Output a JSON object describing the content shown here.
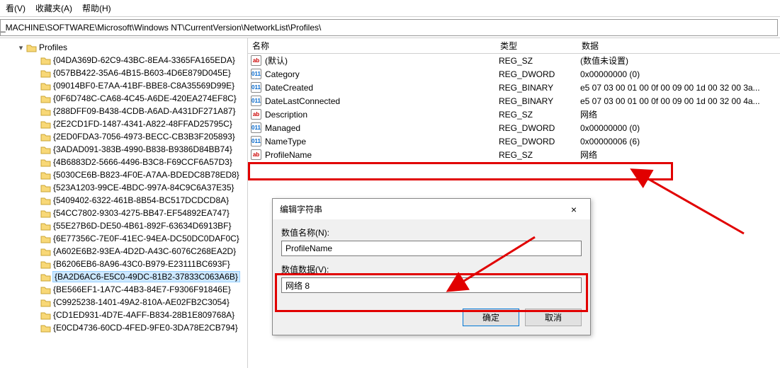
{
  "menubar": {
    "view": "看(V)",
    "favorites": "收藏夹(A)",
    "help": "帮助(H)"
  },
  "addressbar": {
    "path": "_MACHINE\\SOFTWARE\\Microsoft\\Windows NT\\CurrentVersion\\NetworkList\\Profiles\\"
  },
  "tree": {
    "root": "Profiles",
    "items": [
      "{04DA369D-62C9-43BC-8EA4-3365FA165EDA}",
      "{057BB422-35A6-4B15-B603-4D6E879D045E}",
      "{09014BF0-E7AA-41BF-BBE8-C8A35569D99E}",
      "{0F6D748C-CA68-4C45-A6DE-420EA274EF8C}",
      "{288DFF09-B438-4CDB-A6AD-A431DF271A87}",
      "{2E2CD1FD-1487-4341-A822-48FFAD25795C}",
      "{2ED0FDA3-7056-4973-BECC-CB3B3F205893}",
      "{3ADAD091-383B-4990-B838-B9386D84BB74}",
      "{4B6883D2-5666-4496-B3C8-F69CCF6A57D3}",
      "{5030CE6B-B823-4F0E-A7AA-BDEDC8B78ED8}",
      "{523A1203-99CE-4BDC-997A-84C9C6A37E35}",
      "{5409402-6322-461B-8B54-BC517DCDCD8A}",
      "{54CC7802-9303-4275-BB47-EF54892EA747}",
      "{55E27B6D-DE50-4B61-892F-63634D6913BF}",
      "{6E77356C-7E0F-41EC-94EA-DC50DC0DAF0C}",
      "{A602E6B2-93EA-4D2D-A43C-6076C268EA2D}",
      "{B6206EB6-8A96-43C0-B979-E23111BC693F}",
      "{BA2D6AC6-E5C0-49DC-81B2-37833C063A6B}",
      "{BE566EF1-1A7C-44B3-84E7-F9306F91846E}",
      "{C9925238-1401-49A2-810A-AE02FB2C3054}",
      "{CD1ED931-4D7E-4AFF-B834-28B1E809768A}",
      "{E0CD4736-60CD-4FED-9FE0-3DA78E2CB794}"
    ],
    "selected_index": 17
  },
  "list": {
    "headers": {
      "name": "名称",
      "type": "类型",
      "data": "数据"
    },
    "rows": [
      {
        "icon": "sz",
        "name": "(默认)",
        "type": "REG_SZ",
        "data": "(数值未设置)"
      },
      {
        "icon": "bin",
        "name": "Category",
        "type": "REG_DWORD",
        "data": "0x00000000 (0)"
      },
      {
        "icon": "bin",
        "name": "DateCreated",
        "type": "REG_BINARY",
        "data": "e5 07 03 00 01 00 0f 00 09 00 1d 00 32 00 3a..."
      },
      {
        "icon": "bin",
        "name": "DateLastConnected",
        "type": "REG_BINARY",
        "data": "e5 07 03 00 01 00 0f 00 09 00 1d 00 32 00 4a..."
      },
      {
        "icon": "sz",
        "name": "Description",
        "type": "REG_SZ",
        "data": "网络"
      },
      {
        "icon": "bin",
        "name": "Managed",
        "type": "REG_DWORD",
        "data": "0x00000000 (0)"
      },
      {
        "icon": "bin",
        "name": "NameType",
        "type": "REG_DWORD",
        "data": "0x00000006 (6)"
      },
      {
        "icon": "sz",
        "name": "ProfileName",
        "type": "REG_SZ",
        "data": "网络"
      }
    ],
    "highlight_row_index": 7
  },
  "dialog": {
    "title": "编辑字符串",
    "close_label": "×",
    "name_label": "数值名称(N):",
    "name_value": "ProfileName",
    "data_label": "数值数据(V):",
    "data_value": "网络 8",
    "ok": "确定",
    "cancel": "取消"
  },
  "icons": {
    "sz_glyph": "ab",
    "bin_glyph": "011"
  }
}
